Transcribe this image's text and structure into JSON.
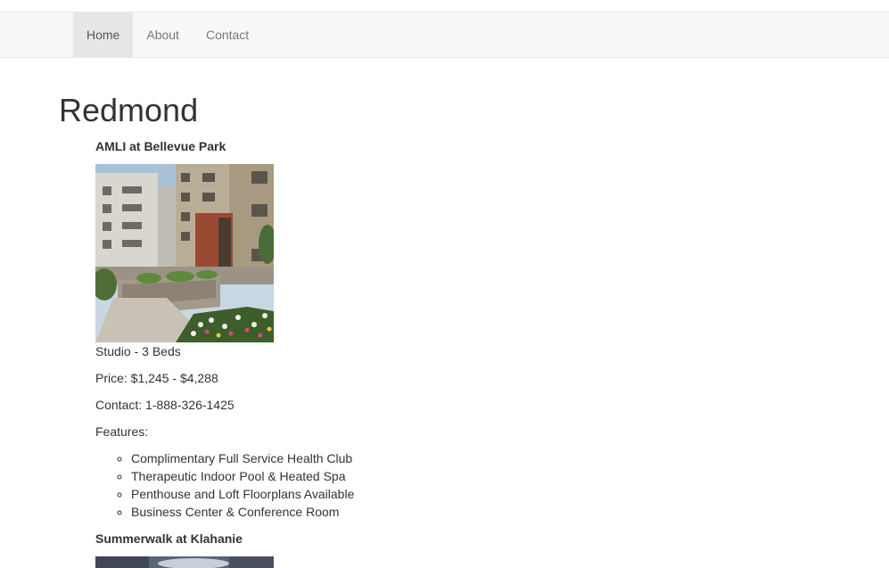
{
  "nav": {
    "items": [
      {
        "label": "Home",
        "active": true
      },
      {
        "label": "About",
        "active": false
      },
      {
        "label": "Contact",
        "active": false
      }
    ]
  },
  "page": {
    "title": "Redmond"
  },
  "listings": [
    {
      "name": "AMLI at Bellevue Park",
      "beds": "Studio - 3 Beds",
      "price": "Price: $1,245 - $4,288",
      "contact": "Contact: 1-888-326-1425",
      "features_label": "Features:",
      "features": [
        "Complimentary Full Service Health Club",
        "Therapeutic Indoor Pool & Heated Spa",
        "Penthouse and Loft Floorplans Available",
        "Business Center & Conference Room"
      ]
    },
    {
      "name": "Summerwalk at Klahanie"
    }
  ],
  "colors": {
    "navbar_bg": "#f8f8f8",
    "nav_active_bg": "#e7e7e7",
    "nav_text": "#777777",
    "text": "#333333"
  }
}
